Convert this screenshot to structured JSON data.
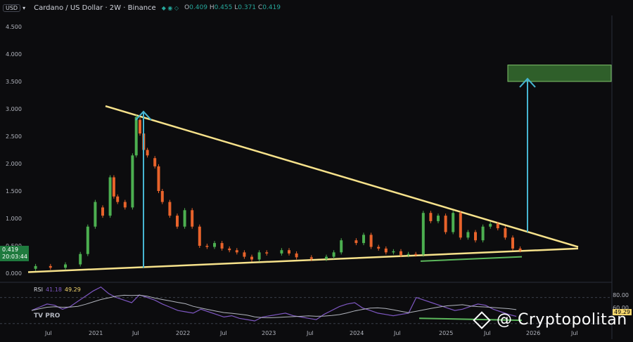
{
  "header": {
    "currency_chip": "USD",
    "symbol_title": "Cardano / US Dollar · 2W · Binance",
    "ohlc_o_label": "O",
    "ohlc_o": "0.409",
    "ohlc_h_label": "H",
    "ohlc_h": "0.455",
    "ohlc_l_label": "L",
    "ohlc_l": "0.371",
    "ohlc_c_label": "C",
    "ohlc_c": "0.419"
  },
  "price_axis": [
    "4.500",
    "4.000",
    "3.500",
    "3.000",
    "2.500",
    "2.000",
    "1.500",
    "1.000",
    "0.500",
    "0.000"
  ],
  "current_price": {
    "value": "0.419",
    "countdown": "20:03:44"
  },
  "time_axis": [
    "Jul",
    "2021",
    "Jul",
    "2022",
    "Jul",
    "2023",
    "Jul",
    "2024",
    "Jul",
    "2025",
    "Jul",
    "2026",
    "Jul"
  ],
  "rsi": {
    "label": "RSI",
    "value1": "41.18",
    "value2": "49.29",
    "levels": [
      "80.00",
      "60.00"
    ],
    "badge": "49.29"
  },
  "tv_logo": "TV PRO",
  "watermark": "@ Cryptopolitan",
  "colors": {
    "up": "#4caf50",
    "down": "#e8632b",
    "triangle": "#f7e28b",
    "arrow": "#46b5d1",
    "target_box": "#2f5f2a",
    "rsi_line": "#7e57c2",
    "rsi_ma": "#b2b5be"
  },
  "chart_data": {
    "type": "candlestick",
    "title": "Cardano / US Dollar · 2W · Binance",
    "y_range": [
      0,
      4.6
    ],
    "x_range": [
      "2020-06",
      "2026-09"
    ],
    "series": [
      {
        "values": [
          [
            "2020-07",
            0.08,
            0.13
          ],
          [
            "2020-09",
            0.13,
            0.1
          ],
          [
            "2020-11",
            0.1,
            0.16
          ],
          [
            "2021-01",
            0.16,
            0.35
          ],
          [
            "2021-02",
            0.35,
            0.85
          ],
          [
            "2021-03",
            0.85,
            1.3
          ],
          [
            "2021-04",
            1.2,
            1.05
          ],
          [
            "2021-05",
            1.05,
            1.75
          ],
          [
            "2021-05b",
            1.75,
            1.4
          ],
          [
            "2021-06",
            1.4,
            1.3
          ],
          [
            "2021-07",
            1.3,
            1.2
          ],
          [
            "2021-08",
            1.2,
            2.15
          ],
          [
            "2021-08b",
            2.15,
            2.85
          ],
          [
            "2021-09",
            2.8,
            2.55
          ],
          [
            "2021-09b",
            2.55,
            2.25
          ],
          [
            "2021-10",
            2.25,
            2.15
          ],
          [
            "2021-11",
            2.1,
            1.95
          ],
          [
            "2021-11b",
            1.95,
            1.5
          ],
          [
            "2021-12",
            1.5,
            1.3
          ],
          [
            "2022-01",
            1.3,
            1.05
          ],
          [
            "2022-02",
            1.05,
            0.85
          ],
          [
            "2022-03",
            0.85,
            1.15
          ],
          [
            "2022-04",
            1.15,
            0.85
          ],
          [
            "2022-05",
            0.85,
            0.5
          ],
          [
            "2022-06",
            0.5,
            0.48
          ],
          [
            "2022-07",
            0.48,
            0.55
          ],
          [
            "2022-08",
            0.55,
            0.45
          ],
          [
            "2022-09",
            0.45,
            0.42
          ],
          [
            "2022-10",
            0.42,
            0.38
          ],
          [
            "2022-11",
            0.38,
            0.3
          ],
          [
            "2022-12",
            0.3,
            0.25
          ],
          [
            "2023-01",
            0.25,
            0.38
          ],
          [
            "2023-02",
            0.38,
            0.36
          ],
          [
            "2023-04",
            0.36,
            0.42
          ],
          [
            "2023-05",
            0.42,
            0.36
          ],
          [
            "2023-06",
            0.36,
            0.29
          ],
          [
            "2023-08",
            0.29,
            0.26
          ],
          [
            "2023-10",
            0.26,
            0.3
          ],
          [
            "2023-11",
            0.3,
            0.38
          ],
          [
            "2023-12",
            0.38,
            0.6
          ],
          [
            "2024-02",
            0.6,
            0.55
          ],
          [
            "2024-03",
            0.55,
            0.7
          ],
          [
            "2024-04",
            0.7,
            0.48
          ],
          [
            "2024-05",
            0.48,
            0.45
          ],
          [
            "2024-06",
            0.45,
            0.38
          ],
          [
            "2024-07",
            0.38,
            0.4
          ],
          [
            "2024-08",
            0.4,
            0.33
          ],
          [
            "2024-09",
            0.33,
            0.35
          ],
          [
            "2024-10",
            0.35,
            0.34
          ],
          [
            "2024-11",
            0.34,
            1.1
          ],
          [
            "2024-12",
            1.1,
            0.95
          ],
          [
            "2025-01",
            0.95,
            1.05
          ],
          [
            "2025-02",
            1.05,
            0.75
          ],
          [
            "2025-03",
            0.75,
            1.1
          ],
          [
            "2025-04",
            1.1,
            0.65
          ],
          [
            "2025-05",
            0.65,
            0.75
          ],
          [
            "2025-06",
            0.75,
            0.6
          ],
          [
            "2025-07",
            0.6,
            0.85
          ],
          [
            "2025-08",
            0.85,
            0.9
          ],
          [
            "2025-09",
            0.9,
            0.82
          ],
          [
            "2025-10",
            0.82,
            0.65
          ],
          [
            "2025-11",
            0.65,
            0.45
          ],
          [
            "2025-12",
            0.45,
            0.419
          ]
        ]
      }
    ],
    "annotations": {
      "triangle_upper": [
        [
          "2020-06",
          3.05
        ],
        [
          "2026-10",
          0.48
        ]
      ],
      "triangle_lower": [
        [
          "2020-06",
          0.02
        ],
        [
          "2026-10",
          0.45
        ]
      ],
      "arrow_2021": {
        "x": "2021-08",
        "from": 0.1,
        "to": 2.95
      },
      "arrow_2025": {
        "x": "2026-01",
        "from": 0.75,
        "to": 3.55
      },
      "target_zone": {
        "x0": "2026-01",
        "x1": "2026-11",
        "y0": 3.5,
        "y1": 3.8
      },
      "support_divergence": [
        [
          "2024-12",
          0.2
        ],
        [
          "2025-11",
          0.3
        ]
      ]
    }
  }
}
